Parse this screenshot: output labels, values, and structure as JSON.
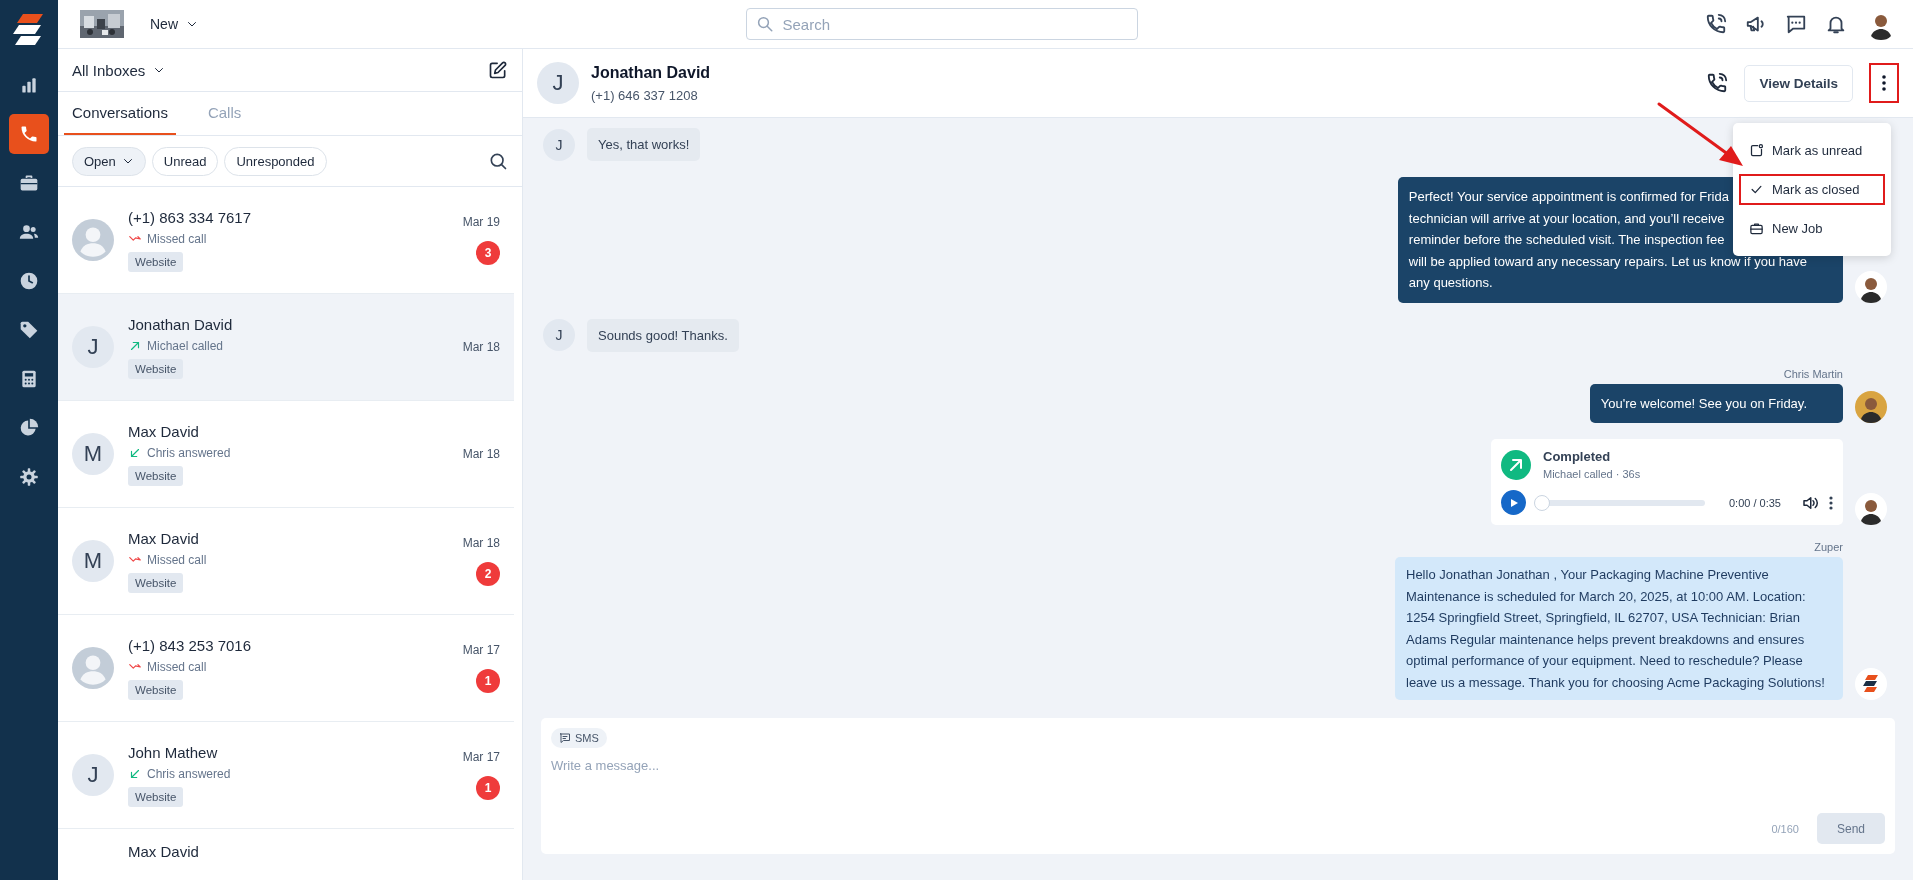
{
  "sidebar": {
    "items": [
      {
        "selected": false
      },
      {
        "selected": true
      },
      {
        "selected": false
      },
      {
        "selected": false
      },
      {
        "selected": false
      },
      {
        "selected": false
      },
      {
        "selected": false
      },
      {
        "selected": false
      },
      {
        "selected": false
      }
    ]
  },
  "topbar": {
    "new_button": "New",
    "search": {
      "placeholder": "Search"
    }
  },
  "inbox": {
    "title": "All Inboxes"
  },
  "tabs": [
    {
      "label": "Conversations",
      "selected": true
    },
    {
      "label": "Calls",
      "selected": false
    }
  ],
  "filters": [
    {
      "label": "Open",
      "kind": "dropdown"
    },
    {
      "label": "Unread",
      "kind": "chip"
    },
    {
      "label": "Unresponded",
      "kind": "chip"
    }
  ],
  "conversations": [
    {
      "name": "(+1) 863 334 7617",
      "avatar": {
        "kind": "person"
      },
      "call": {
        "kind": "missed",
        "text": "Missed call"
      },
      "tag": "Website",
      "date": "Mar 19",
      "unread": "3",
      "selected": false
    },
    {
      "name": "Jonathan David",
      "avatar": {
        "kind": "initial",
        "text": "J"
      },
      "call": {
        "kind": "outgoing",
        "text": "Michael called"
      },
      "tag": "Website",
      "date": "Mar 18",
      "selected": true
    },
    {
      "name": "Max David",
      "avatar": {
        "kind": "initial",
        "text": "M"
      },
      "call": {
        "kind": "incoming",
        "text": "Chris answered"
      },
      "tag": "Website",
      "date": "Mar 18",
      "selected": false
    },
    {
      "name": "Max David",
      "avatar": {
        "kind": "initial",
        "text": "M"
      },
      "call": {
        "kind": "missed",
        "text": "Missed call"
      },
      "tag": "Website",
      "date": "Mar 18",
      "unread": "2",
      "selected": false
    },
    {
      "name": "(+1) 843 253 7016",
      "avatar": {
        "kind": "person"
      },
      "call": {
        "kind": "missed",
        "text": "Missed call"
      },
      "tag": "Website",
      "date": "Mar 17",
      "unread": "1",
      "selected": false
    },
    {
      "name": "John Mathew",
      "avatar": {
        "kind": "initial",
        "text": "J"
      },
      "call": {
        "kind": "incoming",
        "text": "Chris answered"
      },
      "tag": "Website",
      "date": "Mar 17",
      "unread": "1",
      "selected": false
    },
    {
      "name": "Max David",
      "selected": false
    }
  ],
  "chat_header": {
    "avatar": "J",
    "name": "Jonathan David",
    "phone": "(+1) 646 337 1208",
    "view_details": "View Details",
    "more_highlighted": true
  },
  "menu": {
    "items": [
      {
        "kind": "unread",
        "label": "Mark as unread",
        "highlighted": false
      },
      {
        "kind": "closed",
        "label": "Mark as closed",
        "highlighted": true
      },
      {
        "kind": "job",
        "label": "New Job",
        "highlighted": false
      }
    ]
  },
  "messages": [
    {
      "kind": "incoming",
      "avatar": "J",
      "text": "Yes, that works!"
    },
    {
      "kind": "outgoing",
      "lines": [
        "Perfect! Your service appointment is confirmed for Frida",
        "technician will arrive at your location, and you’ll receive",
        "reminder before the scheduled visit. The inspection fee",
        "will be applied toward any necessary repairs. Let us know if you have",
        "any questions."
      ]
    },
    {
      "kind": "incoming",
      "avatar": "J",
      "text": "Sounds good! Thanks."
    },
    {
      "kind": "outgoing",
      "sender": "Chris Martin",
      "lines": [
        "You're welcome! See you on Friday."
      ]
    },
    {
      "kind": "call",
      "status": "Completed",
      "detail": "Michael called · 36s",
      "time": "0:00 / 0:35",
      "level": 0
    },
    {
      "kind": "automated",
      "sender": "Zuper",
      "text": "Hello Jonathan Jonathan , Your Packaging Machine Preventive Maintenance is scheduled for March 20, 2025, at 10:00 AM. Location: 1254 Springfield Street, Springfield, IL 62707, USA Technician: Brian Adams Regular maintenance helps prevent breakdowns and ensures optimal performance of your equipment. Need to reschedule? Please leave us a message. Thank you for choosing Acme Packaging Solutions!"
    }
  ],
  "composer": {
    "channel": "SMS",
    "placeholder": "Write a message...",
    "counter": "0/160",
    "send": "Send"
  }
}
